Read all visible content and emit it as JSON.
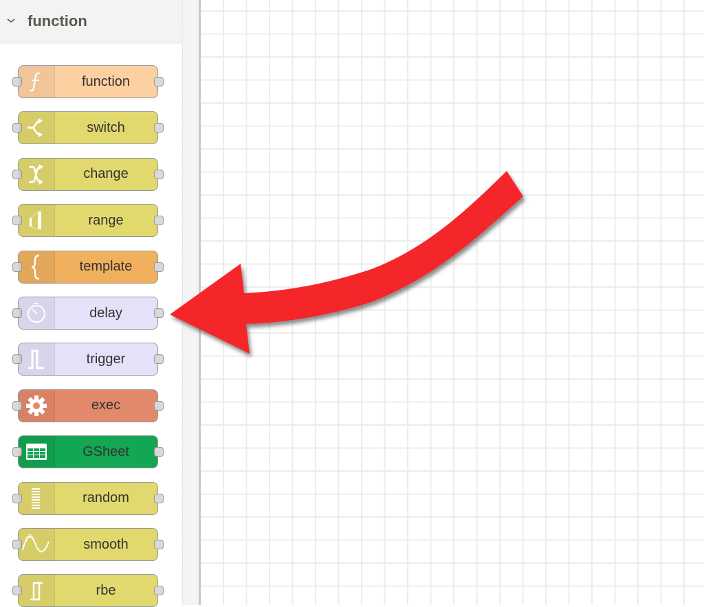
{
  "palette": {
    "category": {
      "label": "function",
      "expanded": true,
      "icon": "chevron-down-icon"
    },
    "nodes": [
      {
        "label": "function",
        "icon": "function-icon",
        "color": "#fdd0a2"
      },
      {
        "label": "switch",
        "icon": "switch-icon",
        "color": "#e2d96e"
      },
      {
        "label": "change",
        "icon": "change-icon",
        "color": "#e2d96e"
      },
      {
        "label": "range",
        "icon": "range-icon",
        "color": "#e2d96e"
      },
      {
        "label": "template",
        "icon": "template-icon",
        "color": "#f0b05e"
      },
      {
        "label": "delay",
        "icon": "timer-icon",
        "color": "#e6e0f8"
      },
      {
        "label": "trigger",
        "icon": "trigger-icon",
        "color": "#e6e0f8"
      },
      {
        "label": "exec",
        "icon": "cog-icon",
        "color": "#e3896b"
      },
      {
        "label": "GSheet",
        "icon": "spreadsheet-icon",
        "color": "#13a653"
      },
      {
        "label": "random",
        "icon": "random-icon",
        "color": "#e2d96e"
      },
      {
        "label": "smooth",
        "icon": "smooth-icon",
        "color": "#e2d96e"
      },
      {
        "label": "rbe",
        "icon": "rbe-icon",
        "color": "#e2d96e"
      }
    ]
  },
  "annotation": {
    "type": "curved-arrow",
    "color": "#f5282b",
    "points_to": "delay"
  }
}
